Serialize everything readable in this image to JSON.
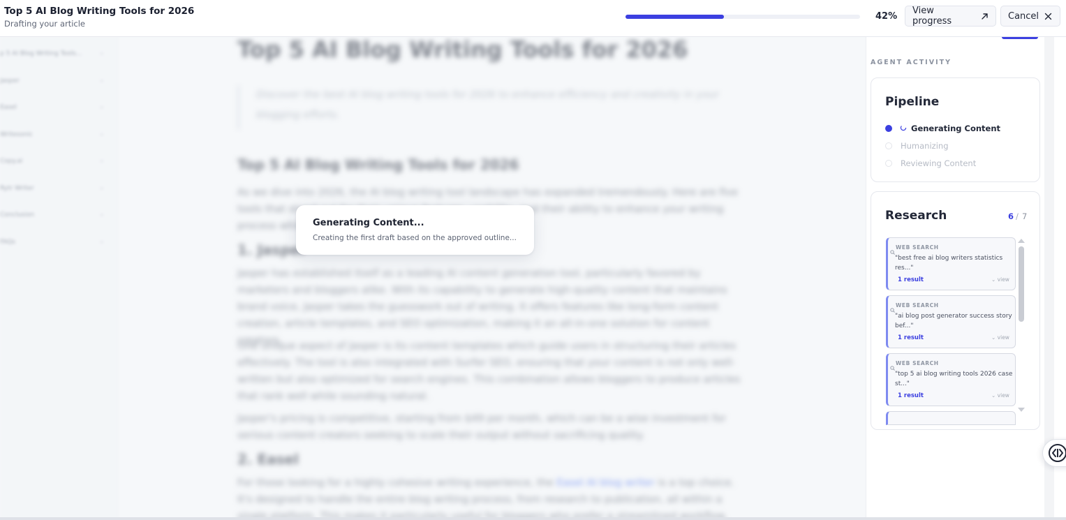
{
  "header": {
    "title": "Top 5 AI Blog Writing Tools for 2026",
    "subtitle": "Drafting your article",
    "progress": {
      "percent": 42,
      "label": "42%"
    },
    "view_progress_label": "View progress",
    "cancel_label": "Cancel"
  },
  "sidebar": {
    "items": [
      {
        "label": "p 5 AI Blog Writing Tools..."
      },
      {
        "label": "Jasper"
      },
      {
        "label": "Easel"
      },
      {
        "label": "Writesonic"
      },
      {
        "label": "Copy.ai"
      },
      {
        "label": "Rytr Writer"
      },
      {
        "label": "Conclusion"
      },
      {
        "label": "FAQs"
      }
    ]
  },
  "article": {
    "title": "Top 5 AI Blog Writing Tools for 2026",
    "intro": "Discover the best AI blog writing tools for 2026 to enhance efficiency and creativity in your blogging efforts.",
    "section_heading": "Top 5 AI Blog Writing Tools for 2026",
    "section_body": "As we dive into 2026, the AI blog writing tool landscape has expanded tremendously. Here are five tools that stand out for their unique features, usability, and their ability to enhance your writing process while boosting productivity.",
    "h_jasper": "1. Jasper",
    "jasper_p1": "Jasper has established itself as a leading AI content generation tool, particularly favored by marketers and bloggers alike. With its capability to generate high-quality content that maintains brand voice, Jasper takes the guesswork out of writing. It offers features like long-form content creation, article templates, and SEO optimization, making it an all-in-one solution for content creators.",
    "jasper_p2": "One unique aspect of Jasper is its content templates which guide users in structuring their articles effectively. The tool is also integrated with Surfer SEO, ensuring that your content is not only well-written but also optimized for search engines. This combination allows bloggers to produce articles that rank well while sounding natural.",
    "jasper_p3": "Jasper's pricing is competitive, starting from $49 per month, which can be a wise investment for serious content creators seeking to scale their output without sacrificing quality.",
    "h_easel": "2. Easel",
    "easel_p1_before": "For those looking for a highly cohesive writing experience, the ",
    "easel_link": "Easel AI blog writer",
    "easel_p1_after": " is a top choice. It's designed to handle the entire blog writing process, from research to publication, all within a single platform. This makes it particularly useful for bloggers who prefer a streamlined workflow."
  },
  "agent_activity": {
    "section_label": "AGENT ACTIVITY",
    "pipeline": {
      "title": "Pipeline",
      "steps": [
        {
          "label": "Generating Content",
          "state": "active"
        },
        {
          "label": "Humanizing",
          "state": "pending"
        },
        {
          "label": "Reviewing Content",
          "state": "pending"
        }
      ]
    },
    "research": {
      "title": "Research",
      "count": "6",
      "separator": "/",
      "total": "7",
      "items": [
        {
          "kind": "WEB SEARCH",
          "query": "\"best free ai blog writers statistics res...\"",
          "result": "1 result",
          "view": "view"
        },
        {
          "kind": "WEB SEARCH",
          "query": "\"ai blog post generator success story bef...\"",
          "result": "1 result",
          "view": "view"
        },
        {
          "kind": "WEB SEARCH",
          "query": "\"top 5 ai blog writing tools 2026 case st...\"",
          "result": "1 result",
          "view": "view"
        }
      ]
    }
  },
  "toast": {
    "title": "Generating Content...",
    "subtitle": "Creating the first draft based on the approved outline..."
  },
  "colors": {
    "accent": "#3b3fe0",
    "link": "#3b64f0",
    "text": "#1f2433",
    "muted": "#5f6676"
  },
  "icons": {
    "view_progress": "arrow-up-right-icon",
    "cancel": "close-icon",
    "pipeline_active": "spinner-icon",
    "research_kind": "search-icon",
    "float_toggle": "code-toggle-icon"
  }
}
